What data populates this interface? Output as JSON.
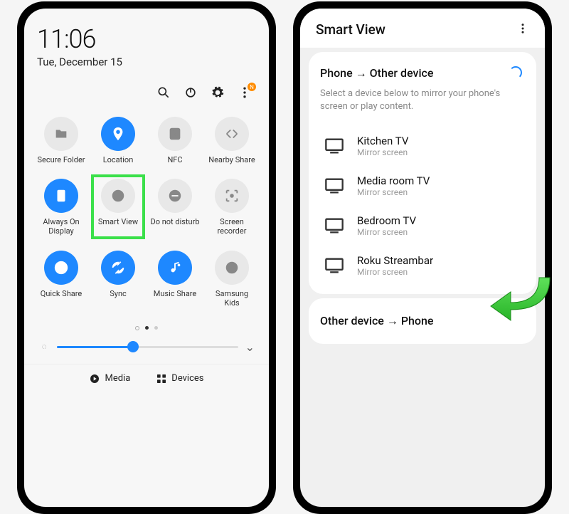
{
  "left": {
    "time": "11:06",
    "date": "Tue, December 15",
    "actions": {
      "search": "search",
      "power": "power",
      "settings": "settings",
      "more": "more",
      "badge": "N"
    },
    "tiles": [
      {
        "id": "secure-folder",
        "label": "Secure Folder",
        "on": false
      },
      {
        "id": "location",
        "label": "Location",
        "on": true
      },
      {
        "id": "nfc",
        "label": "NFC",
        "on": false
      },
      {
        "id": "nearby-share",
        "label": "Nearby Share",
        "on": false
      },
      {
        "id": "always-on-display",
        "label": "Always On Display",
        "on": true
      },
      {
        "id": "smart-view",
        "label": "Smart View",
        "on": false,
        "highlighted": true
      },
      {
        "id": "do-not-disturb",
        "label": "Do not disturb",
        "on": false
      },
      {
        "id": "screen-recorder",
        "label": "Screen recorder",
        "on": false
      },
      {
        "id": "quick-share",
        "label": "Quick Share",
        "on": true
      },
      {
        "id": "sync",
        "label": "Sync",
        "on": true
      },
      {
        "id": "music-share",
        "label": "Music Share",
        "on": true
      },
      {
        "id": "samsung-kids",
        "label": "Samsung Kids",
        "on": false
      }
    ],
    "brightness_pct": 42,
    "bottom": {
      "media": "Media",
      "devices": "Devices"
    }
  },
  "right": {
    "title": "Smart View",
    "section1_title": "Phone → Other device",
    "section1_sub": "Select a device below to mirror your phone's screen or play content.",
    "devices": [
      {
        "name": "Kitchen TV",
        "sub": "Mirror screen"
      },
      {
        "name": "Media room TV",
        "sub": "Mirror screen"
      },
      {
        "name": "Bedroom TV",
        "sub": "Mirror screen"
      },
      {
        "name": "Roku Streambar",
        "sub": "Mirror screen"
      }
    ],
    "section2_title": "Other device → Phone"
  }
}
